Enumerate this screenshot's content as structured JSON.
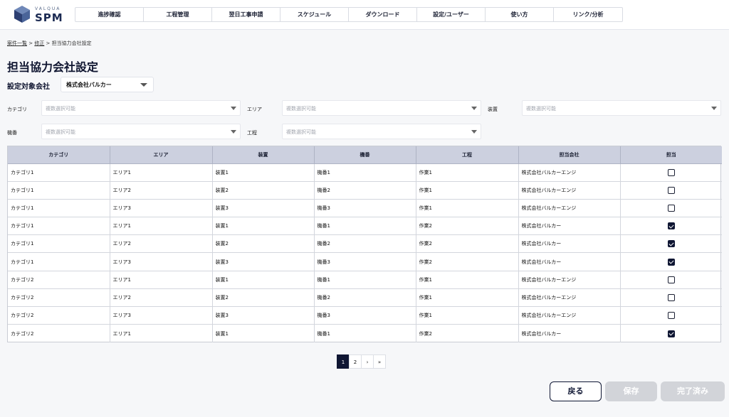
{
  "header": {
    "logo_small": "VALQUA",
    "logo_big": "SPM",
    "nav": [
      "進捗確認",
      "工程管理",
      "翌日工事申請",
      "スケジュール",
      "ダウンロード",
      "設定/ユーザー",
      "使い方",
      "リンク/分析"
    ]
  },
  "breadcrumb": {
    "item1": "案件一覧",
    "sep1": " > ",
    "item2": "修正",
    "sep2": " > ",
    "current": "担当協力会社設定"
  },
  "page_title": "担当協力会社設定",
  "target_company": {
    "label": "設定対象会社",
    "value": "株式会社バルカー"
  },
  "filters": {
    "category": {
      "label": "カテゴリ",
      "placeholder": "複数選択可能"
    },
    "area": {
      "label": "エリア",
      "placeholder": "複数選択可能"
    },
    "device": {
      "label": "装置",
      "placeholder": "複数選択可能"
    },
    "unit": {
      "label": "機番",
      "placeholder": "複数選択可能"
    },
    "process": {
      "label": "工程",
      "placeholder": "複数選択可能"
    }
  },
  "table": {
    "columns": [
      "カテゴリ",
      "エリア",
      "装置",
      "機番",
      "工程",
      "担当会社",
      "担当"
    ],
    "rows": [
      {
        "category": "カテゴリ1",
        "area": "エリア1",
        "device": "装置1",
        "unit": "機番1",
        "process": "作業1",
        "company": "株式会社バルカーエンジ",
        "assigned": false
      },
      {
        "category": "カテゴリ1",
        "area": "エリア2",
        "device": "装置2",
        "unit": "機番2",
        "process": "作業1",
        "company": "株式会社バルカーエンジ",
        "assigned": false
      },
      {
        "category": "カテゴリ1",
        "area": "エリア3",
        "device": "装置3",
        "unit": "機番3",
        "process": "作業1",
        "company": "株式会社バルカーエンジ",
        "assigned": false
      },
      {
        "category": "カテゴリ1",
        "area": "エリア1",
        "device": "装置1",
        "unit": "機番1",
        "process": "作業2",
        "company": "株式会社バルカー",
        "assigned": true
      },
      {
        "category": "カテゴリ1",
        "area": "エリア2",
        "device": "装置2",
        "unit": "機番2",
        "process": "作業2",
        "company": "株式会社バルカー",
        "assigned": true
      },
      {
        "category": "カテゴリ1",
        "area": "エリア3",
        "device": "装置3",
        "unit": "機番3",
        "process": "作業2",
        "company": "株式会社バルカー",
        "assigned": true
      },
      {
        "category": "カテゴリ2",
        "area": "エリア1",
        "device": "装置1",
        "unit": "機番1",
        "process": "作業1",
        "company": "株式会社バルカーエンジ",
        "assigned": false
      },
      {
        "category": "カテゴリ2",
        "area": "エリア2",
        "device": "装置2",
        "unit": "機番2",
        "process": "作業1",
        "company": "株式会社バルカーエンジ",
        "assigned": false
      },
      {
        "category": "カテゴリ2",
        "area": "エリア3",
        "device": "装置3",
        "unit": "機番3",
        "process": "作業1",
        "company": "株式会社バルカーエンジ",
        "assigned": false
      },
      {
        "category": "カテゴリ2",
        "area": "エリア1",
        "device": "装置1",
        "unit": "機番1",
        "process": "作業2",
        "company": "株式会社バルカー",
        "assigned": true
      }
    ]
  },
  "pagination": {
    "pages": [
      "1",
      "2"
    ],
    "current": "1",
    "next": "›",
    "last": "»"
  },
  "buttons": {
    "back": "戻る",
    "save": "保存",
    "done": "完了済み"
  },
  "colors": {
    "primary": "#0f1633",
    "header_row": "#ccd0df",
    "disabled": "#d2d4d9"
  }
}
